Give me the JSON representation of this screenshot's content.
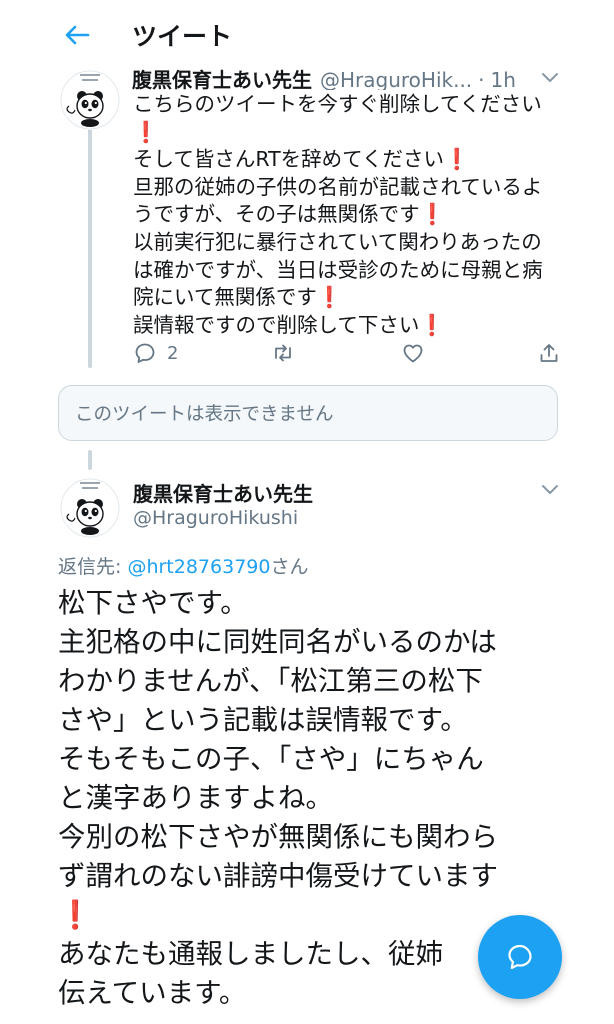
{
  "header": {
    "title": "ツイート"
  },
  "colors": {
    "accent": "#1da1f2",
    "exclamation": "#e0245e",
    "muted": "#657786",
    "text": "#14171a"
  },
  "tweet1": {
    "name": "腹黒保育士あい先生",
    "handle": "@HraguroHik...",
    "separator": "·",
    "time": "1h",
    "lines": [
      {
        "text": "こちらのツイートを今すぐ削除してください",
        "excl": ""
      },
      {
        "text": "",
        "excl": "❗"
      },
      {
        "text": "そして皆さんRTを辞めてください",
        "excl": "❗"
      },
      {
        "text": "旦那の従姉の子供の名前が記載されているよ",
        "excl": ""
      },
      {
        "text": "うですが、その子は無関係です",
        "excl": "❗"
      },
      {
        "text": "以前実行犯に暴行されていて関わりあったの",
        "excl": ""
      },
      {
        "text": "は確かですが、当日は受診のために母親と病",
        "excl": ""
      },
      {
        "text": "院にいて無関係です",
        "excl": "❗"
      },
      {
        "text": "誤情報ですので削除して下さい",
        "excl": "❗"
      }
    ],
    "actions": {
      "reply_count": "2"
    }
  },
  "unavailable": {
    "text": "このツイートは表示できません"
  },
  "tweet2": {
    "name": "腹黒保育士あい先生",
    "handle": "@HraguroHikushi",
    "reply_prefix": "返信先: ",
    "reply_mention": "@hrt28763790",
    "reply_suffix": "さん",
    "lines": [
      {
        "text": "松下さやです。",
        "excl": ""
      },
      {
        "text": "主犯格の中に同姓同名がいるのかは",
        "excl": ""
      },
      {
        "text": "わかりませんが、「松江第三の松下",
        "excl": ""
      },
      {
        "text": "さや」という記載は誤情報です。",
        "excl": ""
      },
      {
        "text": "そもそもこの子、「さや」にちゃん",
        "excl": ""
      },
      {
        "text": "と漢字ありますよね。",
        "excl": ""
      },
      {
        "text": "今別の松下さやが無関係にも関わら",
        "excl": ""
      },
      {
        "text": "ず謂れのない誹謗中傷受けています",
        "excl": ""
      },
      {
        "text": "",
        "excl": "❗"
      },
      {
        "text": "あなたも通報しましたし、従姉",
        "excl": ""
      },
      {
        "text": "伝えています。",
        "excl": ""
      }
    ]
  }
}
